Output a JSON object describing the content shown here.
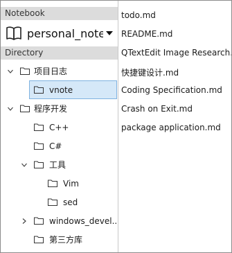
{
  "notebook": {
    "header": "Notebook",
    "current": "personal_notebo"
  },
  "directory": {
    "header": "Directory",
    "items": [
      {
        "label": "项目日志",
        "expanded": true,
        "level": 0
      },
      {
        "label": "vnote",
        "selected": true,
        "level": 1
      },
      {
        "label": "程序开发",
        "expanded": true,
        "level": 0
      },
      {
        "label": "C++",
        "level": 1
      },
      {
        "label": "C#",
        "level": 1
      },
      {
        "label": "工具",
        "expanded": true,
        "level": 1
      },
      {
        "label": "Vim",
        "level": 2
      },
      {
        "label": "sed",
        "level": 2
      },
      {
        "label": "windows_devel...",
        "expanded": false,
        "level": 1
      },
      {
        "label": "第三方库",
        "level": 1
      }
    ]
  },
  "files": [
    "todo.md",
    "README.md",
    "QTextEdit Image Research.md",
    "快捷键设计.md",
    "Coding Specification.md",
    "Crash on Exit.md",
    "package application.md"
  ],
  "colors": {
    "header_bg": "#dcdcdc",
    "selection_bg": "#d5e8f8",
    "selection_border": "#7fb2e0"
  }
}
